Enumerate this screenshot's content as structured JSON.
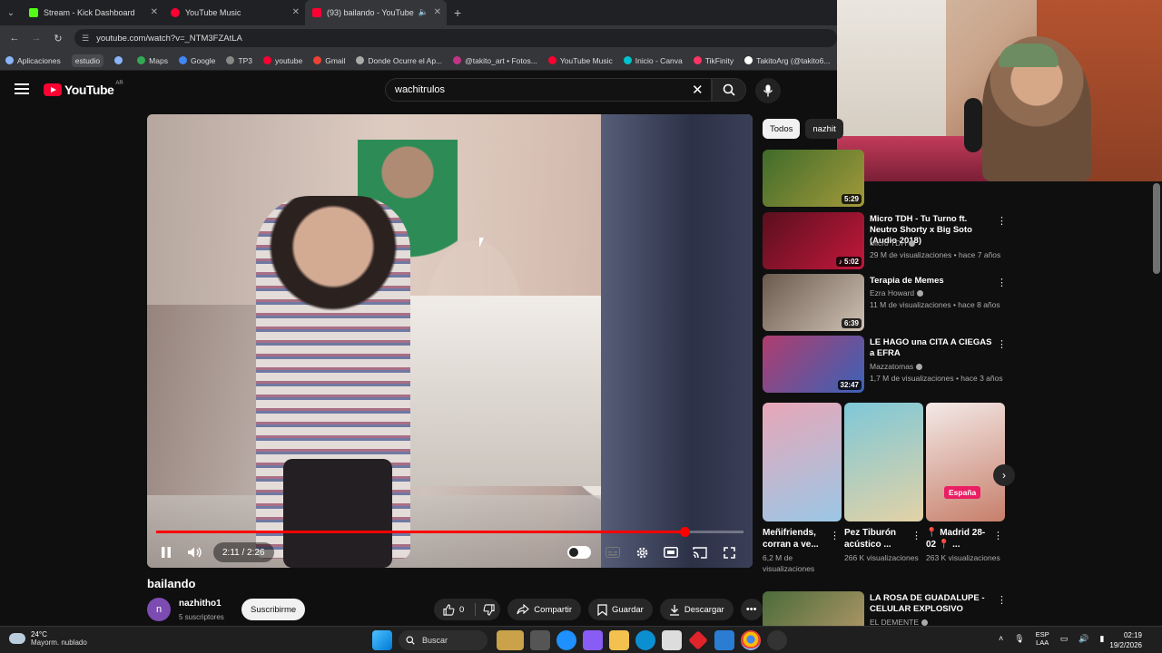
{
  "browser": {
    "tabs": [
      {
        "label": "Stream - Kick Dashboard",
        "color": "#53fc18"
      },
      {
        "label": "YouTube Music",
        "color": "#ff0033"
      },
      {
        "label": "(93) bailando - YouTube",
        "color": "#ff0033"
      }
    ],
    "url": "youtube.com/watch?v=_NTM3FZAtLA",
    "bookmarks": [
      {
        "label": "Aplicaciones",
        "color": "#8ab4f8"
      },
      {
        "label": "estudio",
        "color": ""
      },
      {
        "label": "",
        "color": "#8ab4f8"
      },
      {
        "label": "Maps",
        "color": "#34a853"
      },
      {
        "label": "Google",
        "color": "#4285f4"
      },
      {
        "label": "TP3",
        "color": "#888888"
      },
      {
        "label": "youtube",
        "color": "#ff0033"
      },
      {
        "label": "Gmail",
        "color": "#ea4335"
      },
      {
        "label": "Donde Ocurre el Ap...",
        "color": "#aaaaaa"
      },
      {
        "label": "@takito_art • Fotos...",
        "color": "#c13584"
      },
      {
        "label": "YouTube Music",
        "color": "#ff0033"
      },
      {
        "label": "Inicio - Canva",
        "color": "#00c4cc"
      },
      {
        "label": "TikFinity",
        "color": "#ff3366"
      },
      {
        "label": "TakitoArg (@takito6...",
        "color": "#ffffff"
      },
      {
        "label": "Se",
        "color": "#ffffff"
      }
    ]
  },
  "youtube": {
    "logo_text": "YouTube",
    "country_code": "AR",
    "search_query": "wachitrulos",
    "video": {
      "title": "bailando",
      "time": "2:11 / 2:26",
      "progress": 0.9,
      "channel": "nazhitho1",
      "avatar_letter": "n",
      "subscribers": "5 suscriptores",
      "subscribe_label": "Suscribirme",
      "likes": "0",
      "share_label": "Compartir",
      "save_label": "Guardar",
      "download_label": "Descargar"
    },
    "chips": [
      "Todos",
      "nazhit"
    ],
    "recommendations": [
      {
        "title": "",
        "channel": "",
        "meta": "",
        "duration": "5:29",
        "thumb": [
          "#3f6b2a",
          "#a39a3a"
        ]
      },
      {
        "title": "Micro TDH - Tu Turno ft. Neutro Shorty x Big Soto (Audio 2018)",
        "channel": "Micro TDH",
        "meta": "29 M de visualizaciones • hace 7 años",
        "duration": "♪ 5:02",
        "thumb": [
          "#5a0f1e",
          "#c3183c"
        ]
      },
      {
        "title": "Terapia de Memes",
        "channel": "Ezra Howard",
        "meta": "11 M de visualizaciones • hace 8 años",
        "duration": "6:39",
        "thumb": [
          "#6a5a4e",
          "#cfc2b4"
        ]
      },
      {
        "title": "LE HAGO una CITA A CIEGAS a EFRA",
        "channel": "Mazzatomas",
        "meta": "1,7 M de visualizaciones • hace 3 años",
        "duration": "32:47",
        "thumb": [
          "#b03c6e",
          "#3a63b8"
        ]
      },
      {
        "title": "LA ROSA DE GUADALUPE - CELULAR EXPLOSIVO",
        "channel": "EL DEMENTE",
        "meta": "",
        "duration": "",
        "thumb": [
          "#4b6b3a",
          "#b79a6a"
        ]
      }
    ],
    "shorts": [
      {
        "title": "Meñifriends, corran a ve...",
        "views": "6,2 M de visualizaciones",
        "thumb": [
          "#e8a7b8",
          "#9bc7e6"
        ],
        "badge": ""
      },
      {
        "title": "Pez Tiburón acústico ...",
        "views": "266 K visualizaciones",
        "thumb": [
          "#7ec8d8",
          "#e2d2a6"
        ],
        "badge": ""
      },
      {
        "title": "📍 Madrid 28-02 📍 ...",
        "views": "263 K visualizaciones",
        "thumb": [
          "#f3e9e7",
          "#c77f6a"
        ],
        "badge": "España"
      }
    ]
  },
  "taskbar": {
    "temperature": "24°C",
    "weather": "Mayorm. nublado",
    "search_placeholder": "Buscar",
    "lang_line1": "ESP",
    "lang_line2": "LAA",
    "time": "02:19",
    "date": "19/2/2026"
  }
}
